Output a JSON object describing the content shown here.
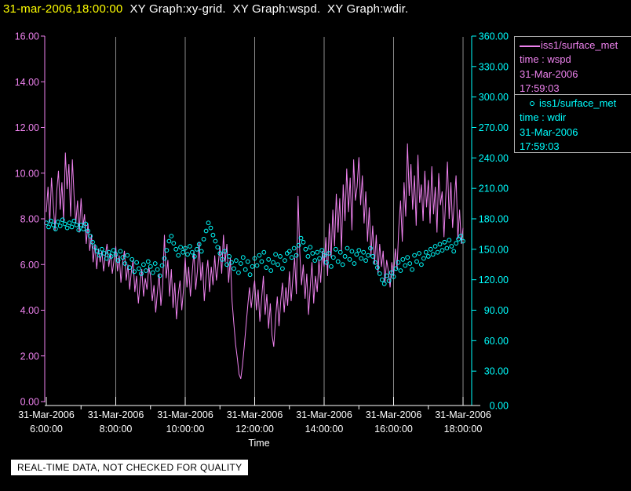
{
  "title": {
    "timestamp": "31-mar-2006,18:00:00",
    "graphs": "XY Graph:xy-grid.  XY Graph:wspd.  XY Graph:wdir."
  },
  "footer": {
    "notice": "REAL-TIME DATA, NOT CHECKED FOR QUALITY"
  },
  "colors": {
    "background": "#000000",
    "title_time": "#ffff00",
    "title_text": "#ffffff",
    "wspd": "#ee82ee",
    "wdir": "#00ffff",
    "x_axis": "#ffffff",
    "grid": "#8c8c8c",
    "legend_border": "#aaaaaa",
    "footer_bg": "#ffffff",
    "footer_text": "#000000"
  },
  "legend": {
    "entries": [
      {
        "symbol": "line-sample",
        "source": "iss1/surface_met",
        "field": "time : wspd",
        "date": "31-Mar-2006",
        "time": "17:59:03",
        "color": "#ee82ee"
      },
      {
        "symbol": "circle-sample",
        "source": "iss1/surface_met",
        "field": "time : wdir",
        "date": "31-Mar-2006",
        "time": "17:59:03",
        "color": "#00ffff"
      }
    ]
  },
  "chart_data": {
    "type": "line+scatter",
    "title": "",
    "xlabel": "Time",
    "x_axis": {
      "start_hour": 6,
      "end_hour": 18,
      "major_ticks": [
        {
          "hour": 6,
          "date": "31-Mar-2006",
          "time": "6:00:00"
        },
        {
          "hour": 8,
          "date": "31-Mar-2006",
          "time": "8:00:00"
        },
        {
          "hour": 10,
          "date": "31-Mar-2006",
          "time": "10:00:00"
        },
        {
          "hour": 12,
          "date": "31-Mar-2006",
          "time": "12:00:00"
        },
        {
          "hour": 14,
          "date": "31-Mar-2006",
          "time": "14:00:00"
        },
        {
          "hour": 16,
          "date": "31-Mar-2006",
          "time": "16:00:00"
        },
        {
          "hour": 18,
          "date": "31-Mar-2006",
          "time": "18:00:00"
        }
      ],
      "minor_tick_hours": [
        7,
        9,
        11,
        13,
        15,
        17
      ],
      "grid_hours": [
        8,
        10,
        12,
        14,
        16,
        18
      ]
    },
    "left_axis": {
      "series": "wspd",
      "min": 0,
      "max": 16,
      "decimals": 2,
      "ticks": [
        16,
        14,
        12,
        10,
        8,
        6,
        4,
        2,
        0
      ]
    },
    "right_axis": {
      "series": "wdir",
      "min": 0,
      "max": 360,
      "decimals": 2,
      "ticks": [
        360,
        330,
        300,
        270,
        240,
        210,
        180,
        150,
        120,
        90,
        60,
        30,
        0
      ]
    },
    "series": [
      {
        "name": "wspd",
        "type": "line",
        "axis": "left",
        "color": "#ee82ee",
        "t_start": 6,
        "dt": 0.05,
        "values": [
          8.3,
          9.4,
          7.8,
          9.8,
          8.6,
          7.5,
          9.2,
          10.1,
          8.4,
          9.6,
          7.9,
          10.9,
          9.3,
          10.4,
          8.1,
          10.6,
          9.0,
          7.8,
          8.8,
          7.4,
          8.9,
          7.6,
          8.2,
          6.9,
          7.8,
          6.6,
          7.3,
          6.1,
          6.9,
          5.8,
          6.7,
          6.1,
          6.6,
          5.7,
          6.4,
          6.9,
          5.9,
          6.5,
          5.6,
          6.2,
          6.8,
          5.7,
          6.4,
          5.2,
          6.1,
          6.6,
          5.3,
          6.0,
          4.9,
          5.7,
          6.2,
          4.8,
          5.5,
          4.3,
          5.2,
          5.8,
          4.6,
          5.4,
          4.9,
          5.9,
          5.5,
          4.4,
          5.1,
          3.9,
          4.8,
          5.6,
          4.2,
          5.0,
          7.3,
          5.4,
          6.2,
          4.6,
          5.8,
          4.1,
          5.2,
          3.6,
          4.7,
          5.3,
          4.0,
          4.9,
          6.3,
          5.0,
          5.9,
          4.6,
          5.6,
          6.6,
          4.9,
          5.7,
          7.0,
          5.3,
          6.1,
          4.4,
          5.5,
          6.2,
          4.8,
          5.9,
          5.1,
          6.4,
          5.3,
          6.0,
          6.8,
          5.6,
          7.3,
          6.1,
          6.9,
          5.2,
          6.3,
          4.4,
          3.4,
          2.5,
          1.9,
          1.2,
          1.0,
          1.6,
          2.4,
          3.3,
          4.2,
          5.0,
          4.1,
          4.8,
          5.3,
          4.0,
          4.9,
          3.5,
          4.5,
          5.5,
          3.8,
          4.7,
          3.2,
          4.3,
          2.9,
          2.4,
          3.6,
          4.6,
          3.3,
          4.4,
          5.2,
          3.9,
          5.0,
          4.2,
          5.7,
          4.4,
          5.4,
          6.3,
          4.7,
          9.0,
          6.5,
          5.1,
          6.0,
          4.5,
          5.6,
          3.8,
          5.0,
          6.1,
          4.3,
          5.5,
          4.8,
          6.2,
          5.2,
          6.6,
          5.9,
          7.2,
          5.5,
          7.8,
          6.3,
          8.4,
          6.8,
          9.1,
          7.4,
          8.9,
          6.6,
          9.5,
          7.9,
          10.2,
          8.3,
          9.8,
          7.5,
          10.6,
          8.8,
          9.4,
          10.7,
          8.6,
          9.9,
          7.8,
          9.2,
          7.0,
          8.5,
          6.4,
          7.7,
          6.0,
          7.3,
          5.6,
          6.9,
          5.9,
          6.6,
          5.2,
          6.2,
          5.7,
          5.0,
          6.1,
          5.5,
          6.7,
          5.8,
          7.6,
          8.8,
          7.0,
          9.6,
          8.1,
          11.3,
          9.0,
          10.4,
          8.4,
          9.9,
          7.7,
          10.8,
          8.7,
          9.5,
          7.9,
          10.1,
          8.5,
          9.7,
          7.8,
          10.3,
          8.2,
          9.4,
          7.4,
          10.0,
          8.6,
          9.2,
          7.2,
          8.9,
          10.5,
          8.0,
          9.6,
          7.6,
          8.8,
          9.9,
          7.1,
          8.4,
          6.9,
          7.6
        ]
      },
      {
        "name": "wdir",
        "type": "scatter",
        "axis": "right",
        "color": "#00ffff",
        "t_start": 6,
        "dt": 0.0666667,
        "values": [
          176,
          172,
          178,
          174,
          170,
          177,
          173,
          179,
          175,
          171,
          176,
          172,
          178,
          174,
          169,
          174,
          170,
          175,
          168,
          163,
          157,
          152,
          148,
          144,
          150,
          146,
          141,
          147,
          143,
          149,
          145,
          139,
          148,
          142,
          136,
          144,
          132,
          140,
          128,
          137,
          131,
          126,
          135,
          129,
          138,
          133,
          127,
          136,
          130,
          124,
          134,
          141,
          149,
          158,
          163,
          156,
          150,
          144,
          152,
          147,
          151,
          145,
          153,
          147,
          143,
          150,
          155,
          148,
          160,
          168,
          176,
          171,
          164,
          158,
          152,
          146,
          140,
          148,
          135,
          143,
          137,
          131,
          139,
          127,
          136,
          142,
          130,
          138,
          125,
          133,
          141,
          134,
          144,
          138,
          147,
          132,
          140,
          129,
          137,
          145,
          135,
          143,
          131,
          139,
          146,
          148,
          142,
          151,
          144,
          154,
          161,
          157,
          150,
          143,
          152,
          146,
          139,
          147,
          141,
          149,
          144,
          137,
          146,
          133,
          142,
          150,
          138,
          147,
          135,
          143,
          151,
          140,
          148,
          136,
          145,
          149,
          141,
          147,
          139,
          144,
          151,
          143,
          137,
          132,
          126,
          120,
          116,
          124,
          119,
          127,
          123,
          131,
          137,
          129,
          140,
          134,
          142,
          136,
          130,
          144,
          138,
          146,
          135,
          141,
          147,
          143,
          150,
          145,
          153,
          147,
          155,
          149,
          157,
          151,
          159,
          153,
          148,
          156,
          160,
          163,
          158
        ]
      }
    ]
  }
}
